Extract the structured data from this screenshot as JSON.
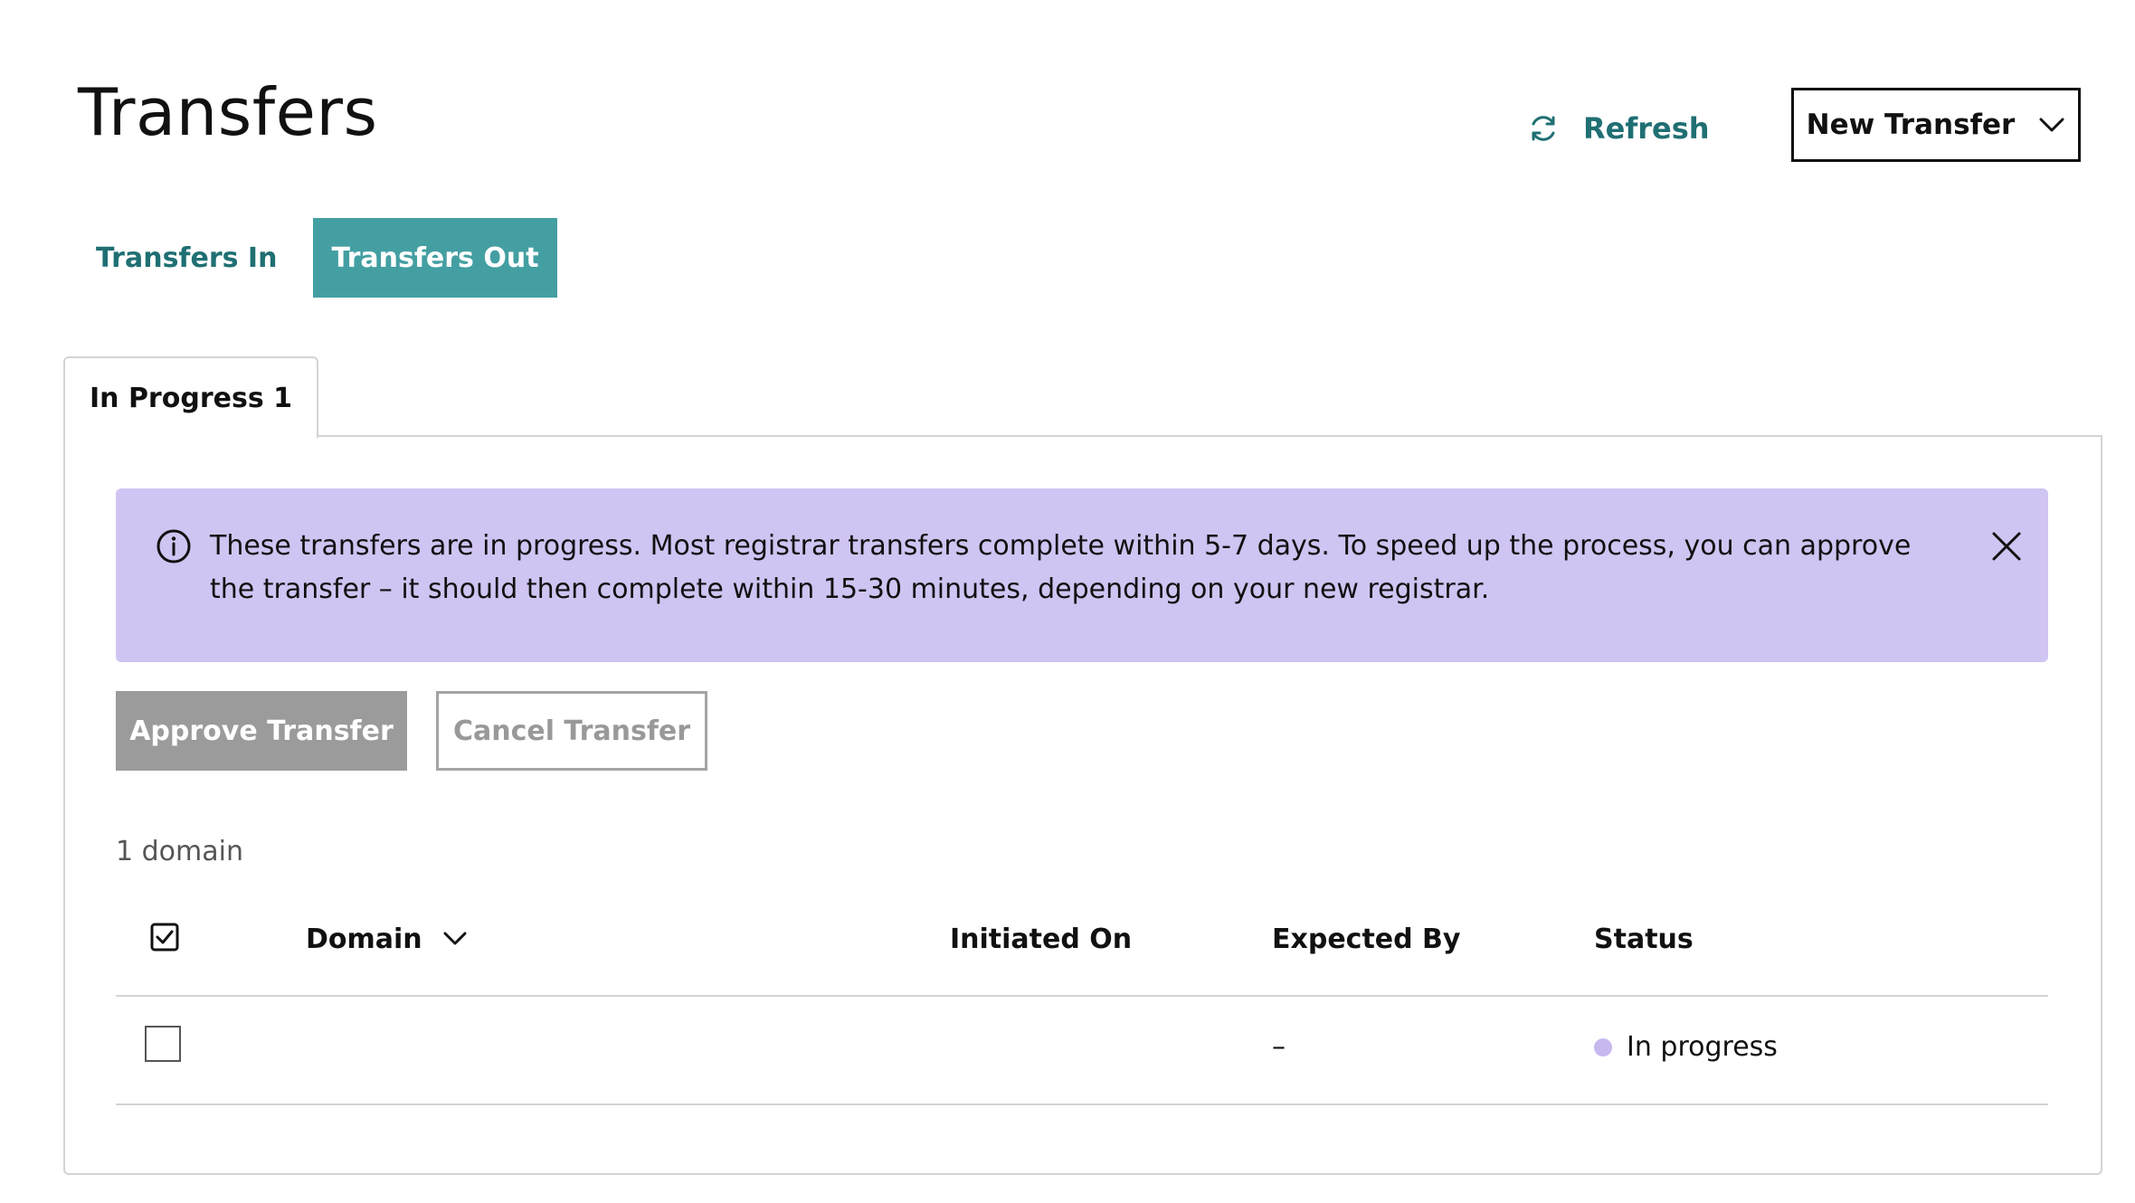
{
  "header": {
    "title": "Transfers",
    "refresh_label": "Refresh",
    "new_transfer_label": "New Transfer"
  },
  "tabs": [
    {
      "label": "Transfers In",
      "active": false
    },
    {
      "label": "Transfers Out",
      "active": true
    }
  ],
  "subtab": {
    "label": "In Progress 1"
  },
  "alert": {
    "message": "These transfers are in progress. Most registrar transfers complete within 5-7 days. To speed up the process, you can approve the transfer – it should then complete within 15-30 minutes, depending on your new registrar.",
    "icon": "info-icon",
    "background": "#d0c4f2"
  },
  "actions": {
    "approve_label": "Approve Transfer",
    "cancel_label": "Cancel Transfer"
  },
  "table": {
    "count_label": "1 domain",
    "columns": [
      "Domain",
      "Initiated On",
      "Expected By",
      "Status"
    ],
    "rows": [
      {
        "domain": "",
        "initiated_on": "",
        "expected_by": "–",
        "status": "In progress"
      }
    ]
  },
  "colors": {
    "accent": "#1f6f73",
    "active_tab": "#449fa2",
    "status_dot": "#c8b8f0"
  }
}
